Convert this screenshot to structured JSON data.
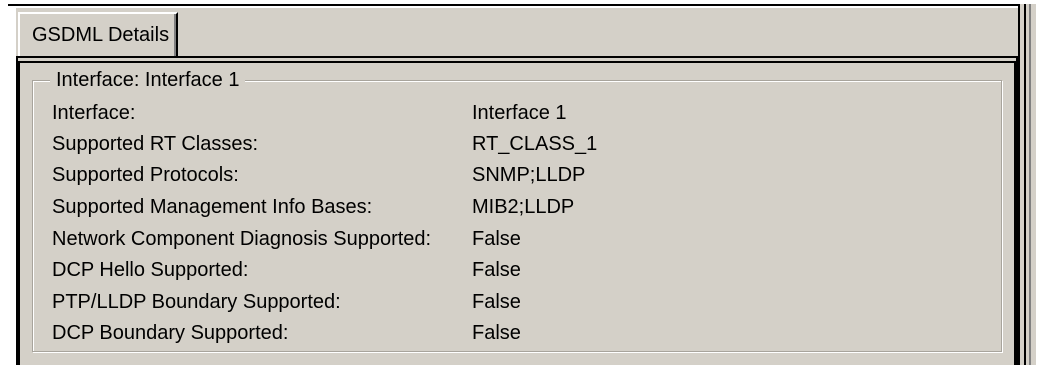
{
  "tabs": [
    {
      "label": "GSDML Details"
    }
  ],
  "group": {
    "title": "Interface: Interface 1"
  },
  "properties": [
    {
      "label": "Interface:",
      "value": "Interface 1"
    },
    {
      "label": "Supported RT Classes:",
      "value": "RT_CLASS_1"
    },
    {
      "label": "Supported Protocols:",
      "value": "SNMP;LLDP"
    },
    {
      "label": "Supported Management Info Bases:",
      "value": "MIB2;LLDP"
    },
    {
      "label": "Network Component Diagnosis Supported:",
      "value": "False"
    },
    {
      "label": "DCP Hello Supported:",
      "value": "False"
    },
    {
      "label": "PTP/LLDP Boundary Supported:",
      "value": "False"
    },
    {
      "label": "DCP Boundary Supported:",
      "value": "False"
    }
  ],
  "colors": {
    "face": "#d4d0c8",
    "dark": "#000000",
    "shadow": "#808080",
    "highlight": "#ffffff"
  }
}
